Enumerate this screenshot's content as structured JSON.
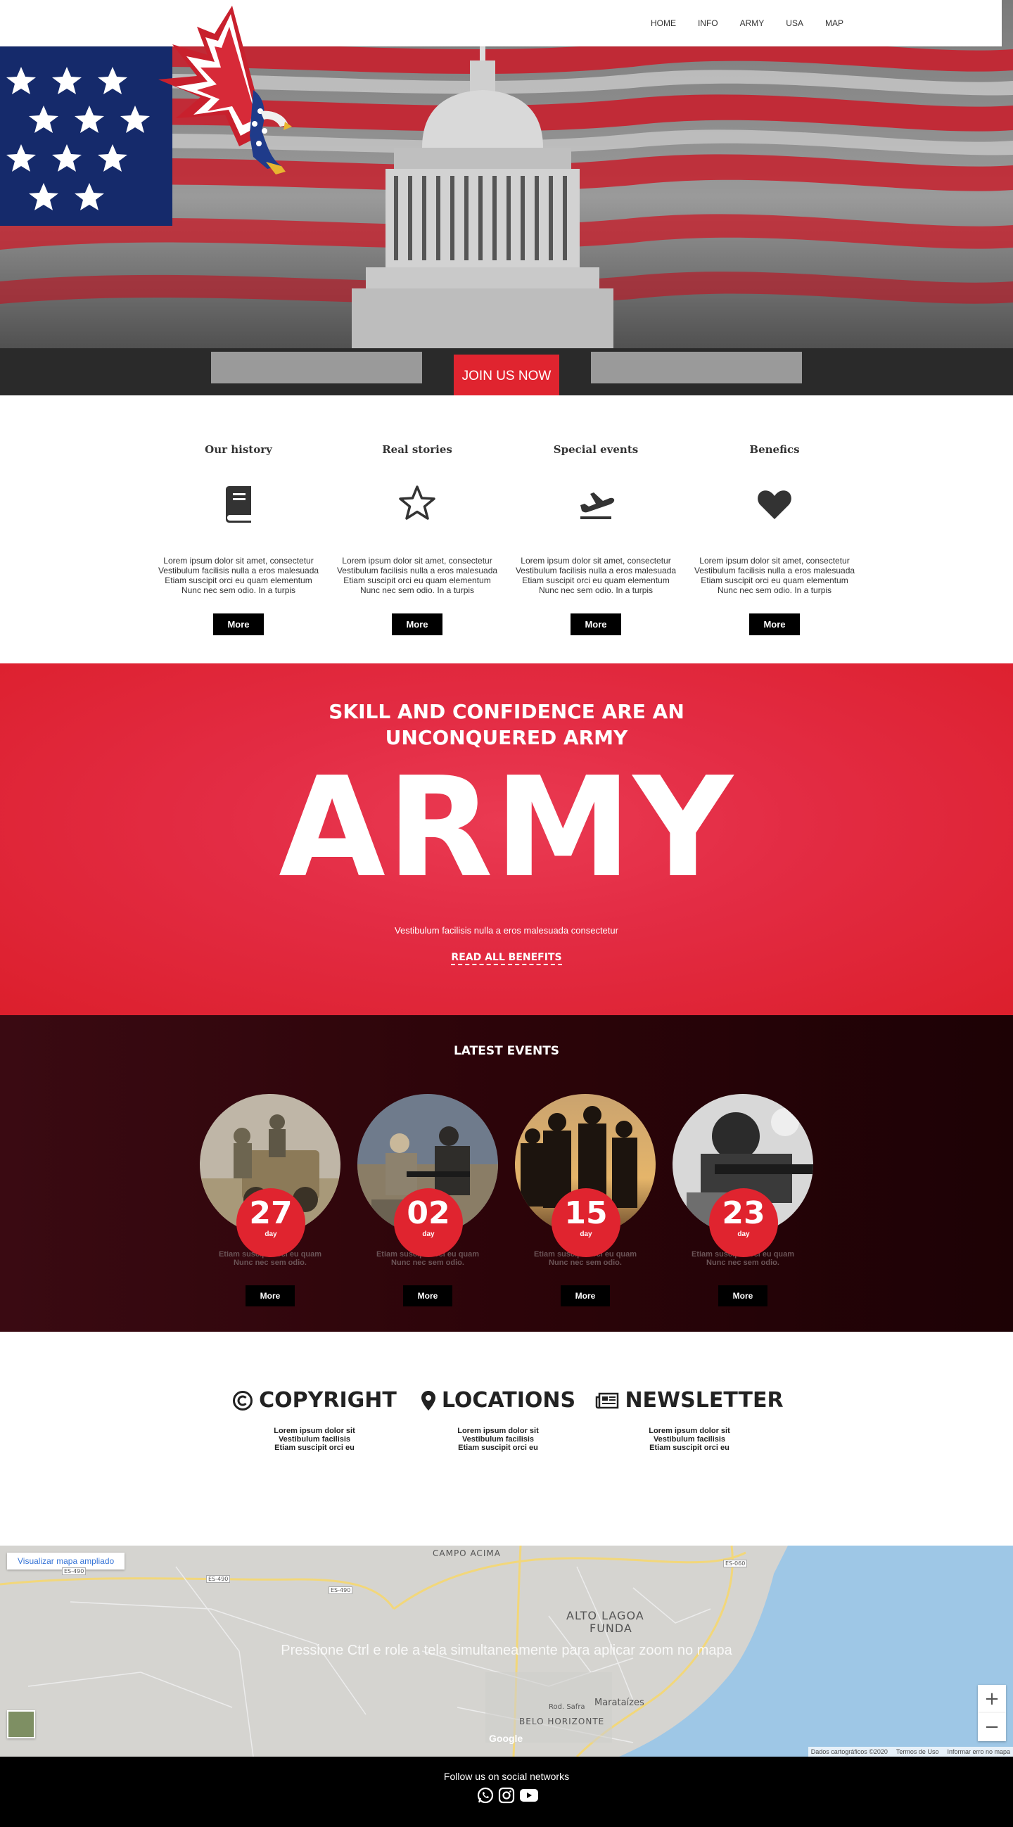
{
  "nav": {
    "items": [
      "HOME",
      "INFO",
      "ARMY",
      "USA",
      "MAP"
    ]
  },
  "hero": {
    "cta": "JOIN US NOW"
  },
  "features": [
    {
      "title": "Our history",
      "icon": "book-icon",
      "text": "Lorem ipsum dolor sit amet, consectetur Vestibulum facilisis nulla a eros malesuada Etiam suscipit orci eu quam elementum Nunc nec sem odio. In a turpis",
      "button": "More"
    },
    {
      "title": "Real stories",
      "icon": "star-icon",
      "text": "Lorem ipsum dolor sit amet, consectetur Vestibulum facilisis nulla a eros malesuada Etiam suscipit orci eu quam elementum Nunc nec sem odio. In a turpis",
      "button": "More"
    },
    {
      "title": "Special events",
      "icon": "plane-departure-icon",
      "text": "Lorem ipsum dolor sit amet, consectetur Vestibulum facilisis nulla a eros malesuada Etiam suscipit orci eu quam elementum Nunc nec sem odio. In a turpis",
      "button": "More"
    },
    {
      "title": "Benefics",
      "icon": "heart-icon",
      "text": "Lorem ipsum dolor sit amet, consectetur Vestibulum facilisis nulla a eros malesuada Etiam suscipit orci eu quam elementum Nunc nec sem odio. In a turpis",
      "button": "More"
    }
  ],
  "army": {
    "heading_line1": "SKILL AND CONFIDENCE ARE AN",
    "heading_line2": "UNCONQUERED ARMY",
    "big": "ARMY",
    "tagline": "Vestibulum facilisis nulla a eros malesuada consectetur",
    "link": "READ ALL BENEFITS"
  },
  "events": {
    "title": "LATEST EVENTS",
    "items": [
      {
        "day": "27",
        "day_label": "day",
        "line1": "Etiam suscipit orci eu quam",
        "line2": "Nunc nec sem odio.",
        "button": "More"
      },
      {
        "day": "02",
        "day_label": "day",
        "line1": "Etiam suscipit orci eu quam",
        "line2": "Nunc nec sem odio.",
        "button": "More"
      },
      {
        "day": "15",
        "day_label": "day",
        "line1": "Etiam suscipit orci eu quam",
        "line2": "Nunc nec sem odio.",
        "button": "More"
      },
      {
        "day": "23",
        "day_label": "day",
        "line1": "Etiam suscipit orci eu quam",
        "line2": "Nunc nec sem odio.",
        "button": "More"
      }
    ]
  },
  "info": [
    {
      "title": "COPYRIGHT",
      "icon": "copyright-icon",
      "lines": [
        "Lorem ipsum dolor sit",
        "Vestibulum facilisis",
        "Etiam suscipit orci eu"
      ]
    },
    {
      "title": "LOCATIONS",
      "icon": "map-marker-icon",
      "lines": [
        "Lorem ipsum dolor sit",
        "Vestibulum facilisis",
        "Etiam suscipit orci eu"
      ]
    },
    {
      "title": "NEWSLETTER",
      "icon": "newspaper-icon",
      "lines": [
        "Lorem ipsum dolor sit",
        "Vestibulum facilisis",
        "Etiam suscipit orci eu"
      ]
    }
  ],
  "map": {
    "view_larger": "Visualizar mapa ampliado",
    "overlay": "Pressione Ctrl e role a tela simultaneamente para aplicar zoom no mapa",
    "labels": {
      "campo": "CAMPO ACIMA",
      "alto1": "ALTO LAGOA",
      "alto2": "FUNDA",
      "belo": "BELO HORIZONTE",
      "marataizes": "Marataízes",
      "rod": "Rod. Safra",
      "es490a": "ES-490",
      "es490b": "ES-490",
      "es490c": "ES-490",
      "es060": "ES-060"
    },
    "zoom_in": "+",
    "zoom_out": "−",
    "google": "Google",
    "attribution": [
      "Dados cartográficos ©2020",
      "Termos de Uso",
      "Informar erro no mapa"
    ]
  },
  "footer": {
    "follow": "Follow us on social networks",
    "social": [
      "whatsapp-icon",
      "instagram-icon",
      "youtube-icon"
    ]
  },
  "colors": {
    "accent": "#e0242f",
    "dark_band": "#2c0409",
    "black": "#000000"
  }
}
